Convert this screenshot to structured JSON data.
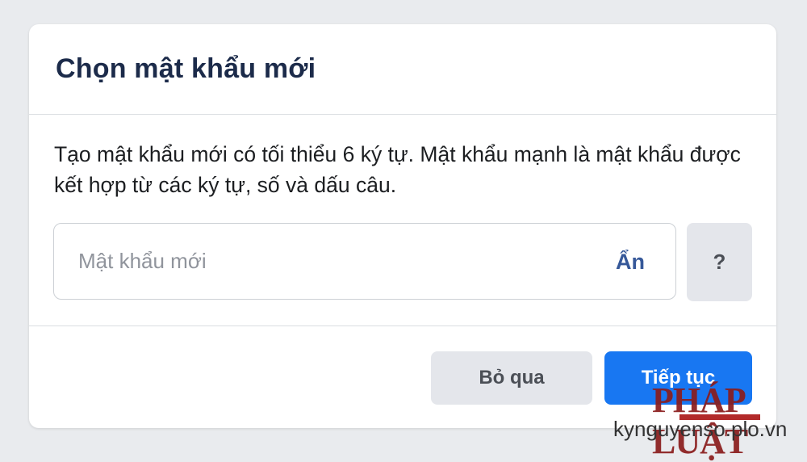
{
  "dialog": {
    "title": "Chọn mật khẩu mới",
    "description": "Tạo mật khẩu mới có tối thiểu 6 ký tự. Mật khẩu mạnh là mật khẩu được kết hợp từ các ký tự, số và dấu câu.",
    "password_field": {
      "placeholder": "Mật khẩu mới",
      "value": "",
      "toggle_label": "Ẩn"
    },
    "help_button_label": "?",
    "skip_button_label": "Bỏ qua",
    "continue_button_label": "Tiếp tục"
  },
  "watermark": {
    "logo_text": "PHÁP LUẬT",
    "url": "kynguyenso.plo.vn"
  },
  "colors": {
    "background": "#e9ebee",
    "primary": "#1877f2",
    "title": "#1c2b4a",
    "link": "#365899",
    "secondary_button": "#e4e6eb"
  },
  "icons": {
    "help": "question-mark-icon"
  }
}
